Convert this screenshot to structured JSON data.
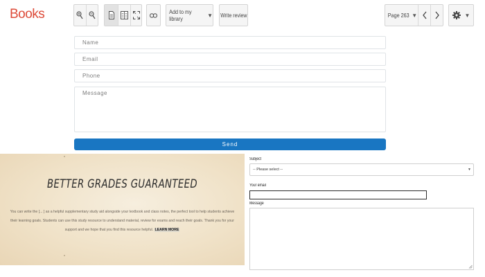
{
  "toolbar": {
    "logo": "Books",
    "add_to_library_label": "Add to my library",
    "write_review_label": "Write review",
    "page_label": "Page 263"
  },
  "contact_form": {
    "name_placeholder": "Name",
    "email_placeholder": "Email",
    "phone_placeholder": "Phone",
    "message_placeholder": "Message",
    "send_label": "Send",
    "accent_color": "#1976c2"
  },
  "banner": {
    "title": "BETTER GRADES GUARANTEED",
    "body": "You can write the [... ] as a helpful supplementary study aid alongside your textbook and class notes, the perfect tool to help students achieve their learning goals. Students can use this study resource to understand material, review for exams and reach their goals. Thank you for your support and we hope that you find this resource helpful.",
    "link_text": "LEARN MORE"
  },
  "side_form": {
    "subject_label": "Subject",
    "subject_value": "-- Please select --",
    "email_label": "Your email",
    "message_label": "Message"
  },
  "icons": [
    "zoom-in-icon",
    "zoom-out-icon",
    "single-page-icon",
    "two-page-icon",
    "fullscreen-icon",
    "link-icon",
    "chevron-left-icon",
    "chevron-right-icon",
    "gear-icon"
  ]
}
